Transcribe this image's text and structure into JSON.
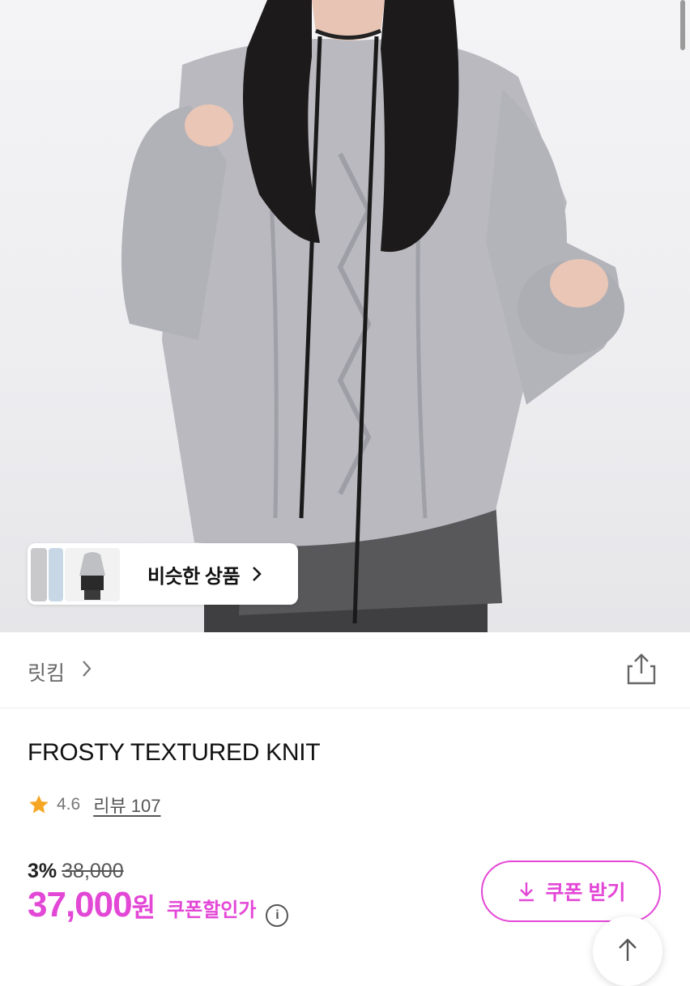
{
  "similar_products": {
    "label": "비슷한 상품"
  },
  "brand": {
    "name": "릿킴"
  },
  "product": {
    "title": "FROSTY TEXTURED KNIT",
    "rating": "4.6",
    "review_label": "리뷰 107"
  },
  "price": {
    "discount_rate": "3%",
    "original_price": "38,000",
    "final_price": "37,000",
    "currency_unit": "원",
    "coupon_price_label": "쿠폰할인가",
    "info_symbol": "i"
  },
  "coupon_button": {
    "label": "쿠폰 받기"
  },
  "icons": {
    "share": "share-icon",
    "star": "star-icon",
    "download": "download-icon",
    "scroll_top": "arrow-up-icon",
    "chevron": "chevron-right-icon"
  },
  "colors": {
    "accent": "#e347d6",
    "star": "#f5a623",
    "sweater": "#b9b9bf"
  }
}
